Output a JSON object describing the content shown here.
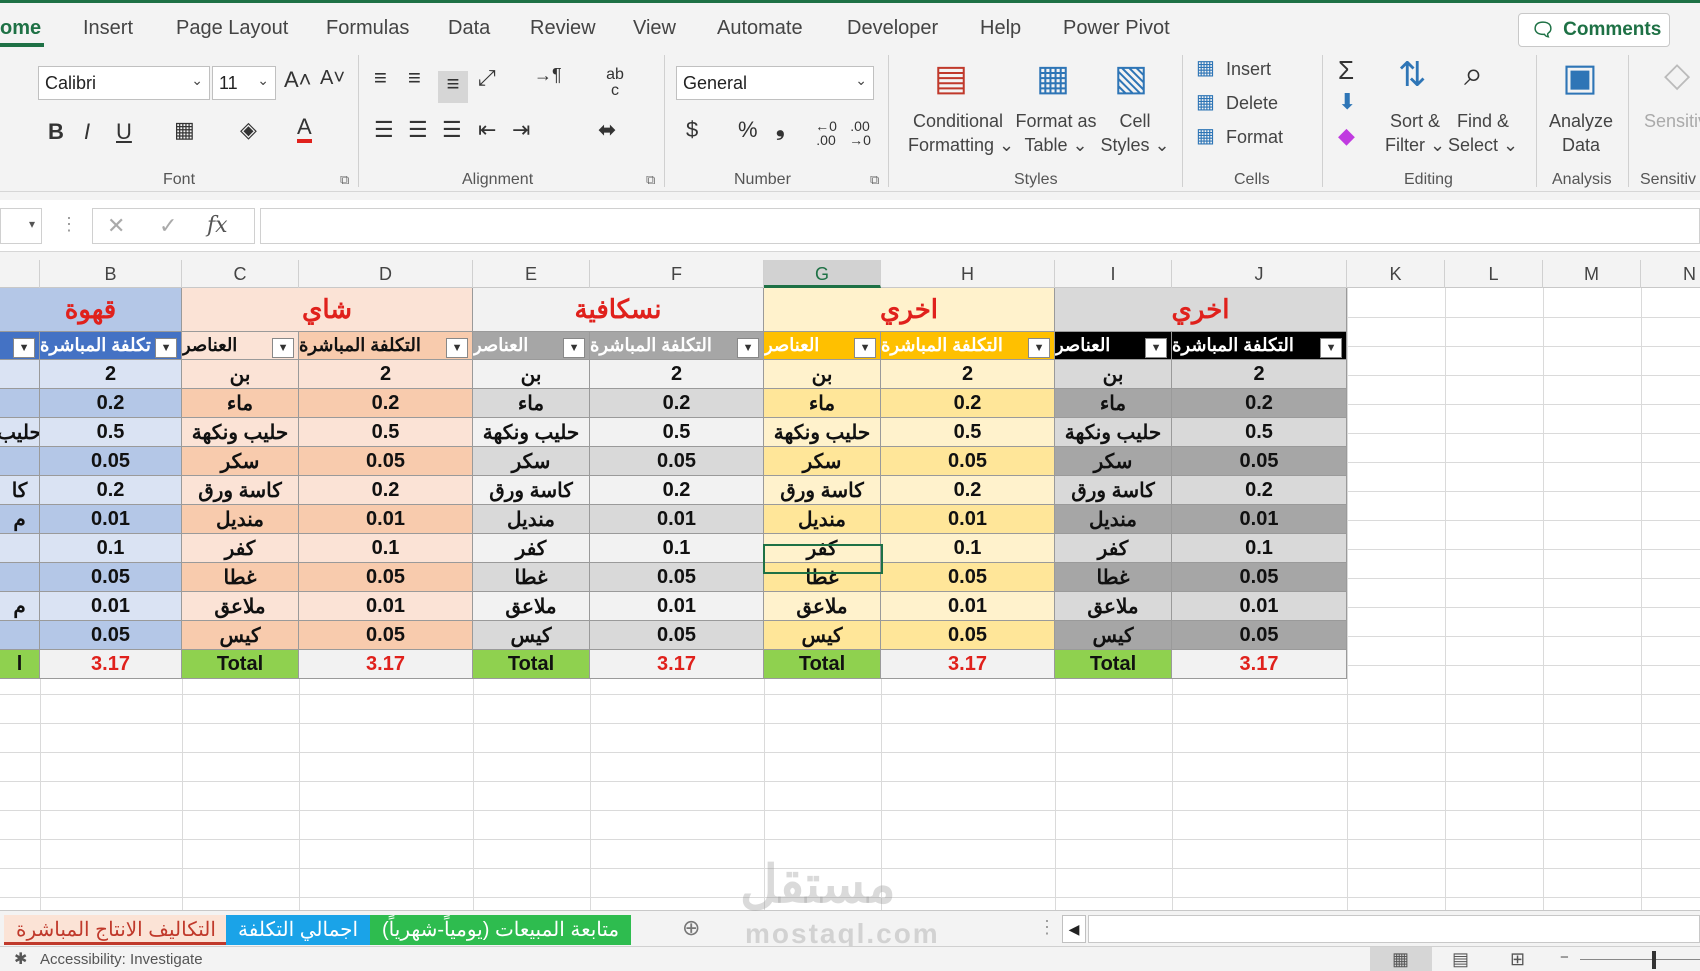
{
  "menu": {
    "tabs": [
      "ome",
      "Insert",
      "Page Layout",
      "Formulas",
      "Data",
      "Review",
      "View",
      "Automate",
      "Developer",
      "Help",
      "Power Pivot"
    ],
    "comments_label": "Comments"
  },
  "ribbon": {
    "font_name": "Calibri",
    "font_size": "11",
    "number_format": "General",
    "groups": {
      "font": "Font",
      "alignment": "Alignment",
      "number": "Number",
      "styles": "Styles",
      "cells": "Cells",
      "editing": "Editing",
      "analysis": "Analysis",
      "sensitivity": "Sensitiv"
    },
    "conditional_formatting": [
      "Conditional",
      "Formatting ⌄"
    ],
    "format_as_table": [
      "Format as",
      "Table ⌄"
    ],
    "cell_styles": [
      "Cell",
      "Styles ⌄"
    ],
    "insert_label": "Insert",
    "delete_label": "Delete",
    "format_label": "Format",
    "sort_filter": [
      "Sort &",
      "Filter ⌄"
    ],
    "find_select": [
      "Find &",
      "Select ⌄"
    ],
    "analyze_data": [
      "Analyze",
      "Data"
    ],
    "sensitivity": [
      "Sensitiv",
      ""
    ],
    "bold": "B",
    "italic": "I",
    "underline": "U",
    "font_color_letter": "A",
    "grow": "A˄",
    "shrink": "A˅",
    "currency": "$",
    "percent": "%",
    "comma": "❟",
    "inc_dec": "←0 .00",
    "dec_dec": ".00 →0",
    "wrap": "ab c"
  },
  "formula_bar": {
    "fx": "fx",
    "value": ""
  },
  "columns": [
    "B",
    "C",
    "D",
    "E",
    "F",
    "G",
    "H",
    "I",
    "J",
    "K",
    "L",
    "M",
    "N"
  ],
  "tables": [
    {
      "title": "قهوة",
      "header_a": "",
      "header_b": "تكلفة المباشرة",
      "items": [
        "",
        "",
        "حليب",
        "",
        "كا",
        "م",
        "",
        "",
        "م",
        ""
      ],
      "costs": [
        "2",
        "0.2",
        "0.5",
        "0.05",
        "0.2",
        "0.01",
        "0.1",
        "0.05",
        "0.01",
        "0.05"
      ],
      "total_label": "l",
      "total_value": "3.17"
    },
    {
      "title": "شاي",
      "header_a": "العناصر",
      "header_b": "التكلفة المباشرة",
      "items": [
        "بن",
        "ماء",
        "حليب ونكهة",
        "سكر",
        "كاسة ورق",
        "منديل",
        "كفر",
        "غطا",
        "ملاعق",
        "كيس"
      ],
      "costs": [
        "2",
        "0.2",
        "0.5",
        "0.05",
        "0.2",
        "0.01",
        "0.1",
        "0.05",
        "0.01",
        "0.05"
      ],
      "total_label": "Total",
      "total_value": "3.17"
    },
    {
      "title": "نسكافية",
      "header_a": "العناصر",
      "header_b": "التكلفة المباشرة",
      "items": [
        "بن",
        "ماء",
        "حليب ونكهة",
        "سكر",
        "كاسة ورق",
        "منديل",
        "كفر",
        "غطا",
        "ملاعق",
        "كيس"
      ],
      "costs": [
        "2",
        "0.2",
        "0.5",
        "0.05",
        "0.2",
        "0.01",
        "0.1",
        "0.05",
        "0.01",
        "0.05"
      ],
      "total_label": "Total",
      "total_value": "3.17"
    },
    {
      "title": "اخري",
      "header_a": "العناصر",
      "header_b": "التكلفة المباشرة",
      "items": [
        "بن",
        "ماء",
        "حليب ونكهة",
        "سكر",
        "كاسة ورق",
        "منديل",
        "كفر",
        "غطا",
        "ملاعق",
        "كيس"
      ],
      "costs": [
        "2",
        "0.2",
        "0.5",
        "0.05",
        "0.2",
        "0.01",
        "0.1",
        "0.05",
        "0.01",
        "0.05"
      ],
      "total_label": "Total",
      "total_value": "3.17"
    },
    {
      "title": "اخري",
      "header_a": "العناصر",
      "header_b": "التكلفة المباشرة",
      "items": [
        "بن",
        "ماء",
        "حليب ونكهة",
        "سكر",
        "كاسة ورق",
        "منديل",
        "كفر",
        "غطا",
        "ملاعق",
        "كيس"
      ],
      "costs": [
        "2",
        "0.2",
        "0.5",
        "0.05",
        "0.2",
        "0.01",
        "0.1",
        "0.05",
        "0.01",
        "0.05"
      ],
      "total_label": "Total",
      "total_value": "3.17"
    }
  ],
  "sheets": [
    "التكاليف الانتاج المباشرة",
    "اجمالي التكلفة",
    "متابعة المبيعات (يومياً-شهرياً)"
  ],
  "status": {
    "accessibility": "Accessibility: Investigate"
  },
  "watermark": {
    "ar": "مستقل",
    "en": "mostaql.com"
  },
  "colors": {
    "accent": "#1e7145",
    "title_red": "#e0211c",
    "total_green": "#8fd14f"
  }
}
